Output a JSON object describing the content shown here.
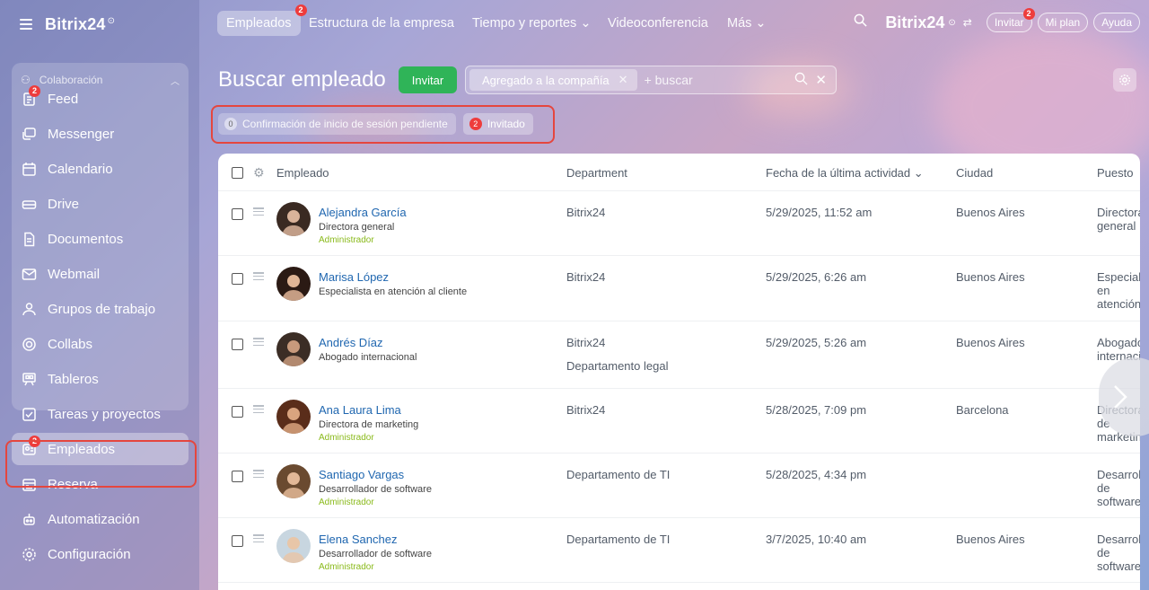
{
  "app": {
    "brand": "Bitrix24",
    "brand_mark": "⊙"
  },
  "sidebar": {
    "group_title": "Colaboración",
    "items": [
      {
        "label": "Feed",
        "icon": "feed-icon",
        "badge": "2"
      },
      {
        "label": "Messenger",
        "icon": "messenger-icon"
      },
      {
        "label": "Calendario",
        "icon": "calendar-icon"
      },
      {
        "label": "Drive",
        "icon": "drive-icon"
      },
      {
        "label": "Documentos",
        "icon": "documents-icon"
      },
      {
        "label": "Webmail",
        "icon": "webmail-icon"
      },
      {
        "label": "Grupos de trabajo",
        "icon": "workgroups-icon"
      },
      {
        "label": "Collabs",
        "icon": "collabs-icon"
      },
      {
        "label": "Tableros",
        "icon": "boards-icon"
      },
      {
        "label": "Tareas y proyectos",
        "icon": "tasks-icon"
      },
      {
        "label": "Empleados",
        "icon": "employees-icon",
        "badge": "2",
        "active": true
      },
      {
        "label": "Reserva",
        "icon": "booking-icon"
      },
      {
        "label": "Automatización",
        "icon": "automation-icon"
      },
      {
        "label": "Configuración",
        "icon": "settings-icon"
      }
    ]
  },
  "topbar": {
    "tabs": [
      {
        "label": "Empleados",
        "badge": "2",
        "active": true
      },
      {
        "label": "Estructura de la empresa"
      },
      {
        "label": "Tiempo y reportes ⌄"
      },
      {
        "label": "Videoconferencia"
      },
      {
        "label": "Más ⌄"
      }
    ],
    "invite_label": "Invitar",
    "invite_badge": "2",
    "plan_label": "Mi plan",
    "help_label": "Ayuda"
  },
  "page": {
    "title": "Buscar empleado",
    "invite_button": "Invitar",
    "filter_chip": "Agregado a la compañía",
    "search_placeholder": "+ buscar",
    "quick_filters": [
      {
        "count": "0",
        "label": "Confirmación de inicio de sesión pendiente"
      },
      {
        "count": "2",
        "label": "Invitado"
      }
    ]
  },
  "table": {
    "columns": {
      "employee": "Empleado",
      "department": "Department",
      "last_activity": "Fecha de la última actividad ⌄",
      "city": "Ciudad",
      "position": "Puesto"
    },
    "rows": [
      {
        "name": "Alejandra García",
        "role": "Directora general",
        "admin": "Administrador",
        "dept": "Bitrix24",
        "dept2": "",
        "date": "5/29/2025, 11:52 am",
        "city": "Buenos Aires",
        "position": "Directora general"
      },
      {
        "name": "Marisa López",
        "role": "Especialista en atención al cliente",
        "admin": "",
        "dept": "Bitrix24",
        "dept2": "",
        "date": "5/29/2025, 6:26 am",
        "city": "Buenos Aires",
        "position": "Especialista en atención al cliente"
      },
      {
        "name": "Andrés Díaz",
        "role": "Abogado internacional",
        "admin": "",
        "dept": "Bitrix24",
        "dept2": "Departamento legal",
        "date": "5/29/2025, 5:26 am",
        "city": "Buenos Aires",
        "position": "Abogado internacional"
      },
      {
        "name": "Ana Laura Lima",
        "role": "Directora de marketing",
        "admin": "Administrador",
        "dept": "Bitrix24",
        "dept2": "",
        "date": "5/28/2025, 7:09 pm",
        "city": "Barcelona",
        "position": "Directora de marketing"
      },
      {
        "name": "Santiago Vargas",
        "role": "Desarrollador de software",
        "admin": "Administrador",
        "dept": "Departamento de TI",
        "dept2": "",
        "date": "5/28/2025, 4:34 pm",
        "city": "",
        "position": "Desarrollador de software"
      },
      {
        "name": "Elena Sanchez",
        "role": "Desarrollador de software",
        "admin": "Administrador",
        "dept": "Departamento de TI",
        "dept2": "",
        "date": "3/7/2025, 10:40 am",
        "city": "Buenos Aires",
        "position": "Desarrollador de software"
      }
    ]
  },
  "colors": {
    "accent_green": "#2fb458",
    "badge_red": "#ee3c3c",
    "link_blue": "#2067b0",
    "admin_green": "#8aba1b",
    "highlight_red": "#e5463e"
  }
}
